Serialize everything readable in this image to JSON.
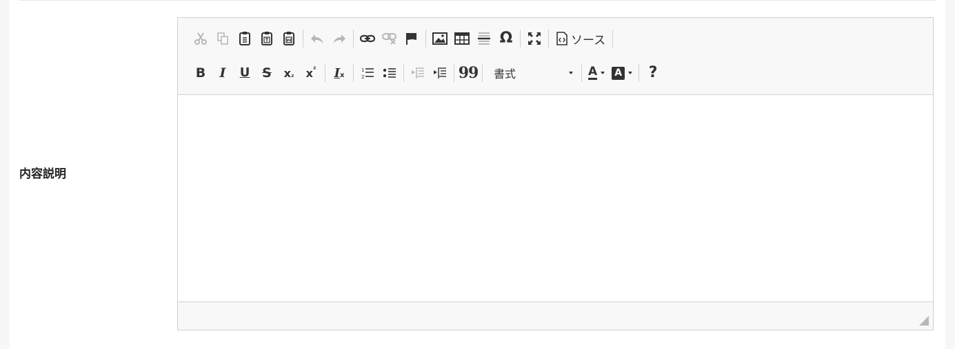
{
  "field": {
    "label": "内容説明"
  },
  "toolbar": {
    "row1": {
      "cut": "cut-icon",
      "copy": "copy-icon",
      "paste": "paste-icon",
      "paste_text": "paste-text-icon",
      "paste_word": "paste-word-icon",
      "undo": "undo-icon",
      "redo": "redo-icon",
      "link": "link-icon",
      "unlink": "unlink-icon",
      "anchor": "anchor-flag-icon",
      "image": "image-icon",
      "table": "table-icon",
      "hr": "horizontal-rule-icon",
      "special_char": "Ω",
      "maximize": "maximize-icon",
      "source_label": "ソース"
    },
    "row2": {
      "bold": "B",
      "italic": "I",
      "underline": "U",
      "strike": "S",
      "subscript_base": "x",
      "subscript_mark": "₂",
      "superscript_base": "x",
      "superscript_mark": "²",
      "remove_format_base": "I",
      "remove_format_mark": "x",
      "numbered_list": "numbered-list-icon",
      "bulleted_list": "bulleted-list-icon",
      "outdent": "outdent-icon",
      "indent": "indent-icon",
      "blockquote": "99",
      "format_label": "書式",
      "text_color_letter": "A",
      "bg_color_letter": "A",
      "help": "?"
    }
  },
  "content": {
    "text": ""
  }
}
